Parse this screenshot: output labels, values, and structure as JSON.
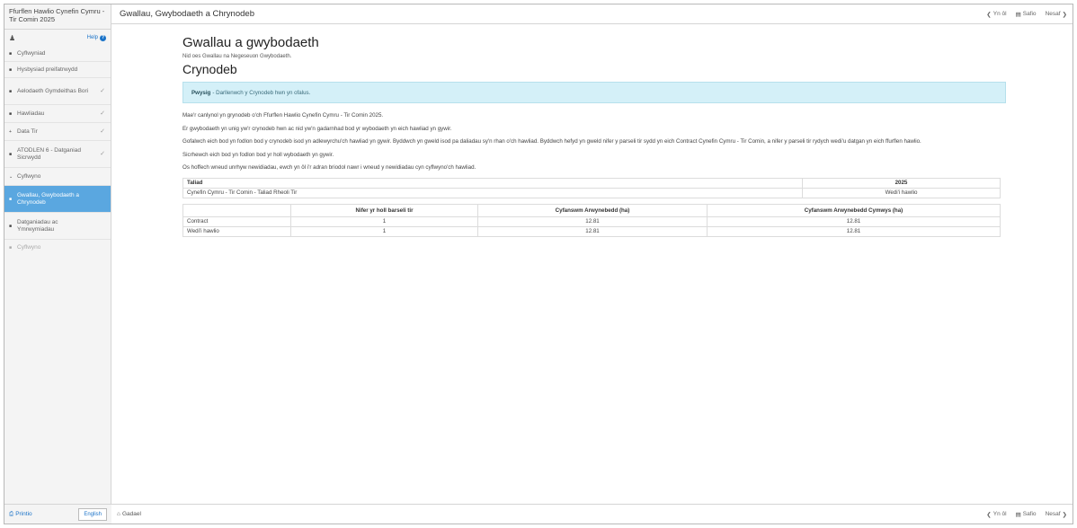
{
  "app": {
    "title": "Ffurflen Hawlio Cynefin Cymru - Tir Comin 2025"
  },
  "sidebar": {
    "help_label": "Help",
    "items": [
      {
        "label": "Cyflwyniad",
        "state": "normal",
        "check": false
      },
      {
        "label": "Hysbysiad preifatrwydd",
        "state": "normal",
        "check": false
      },
      {
        "label": "Aelodaeth Gymdeithas Bori",
        "state": "normal",
        "check": true
      },
      {
        "label": "Hawliadau",
        "state": "normal",
        "check": true
      },
      {
        "label": "Data Tir",
        "state": "normal",
        "check": true
      },
      {
        "label": "ATODLEN 6 - Datganiad Sicrwydd",
        "state": "normal",
        "check": true
      },
      {
        "label": "Cyflwyno",
        "state": "group",
        "check": false
      },
      {
        "label": "Gwallau, Gwybodaeth a Chrynodeb",
        "state": "active",
        "check": false
      },
      {
        "label": "Datganiadau ac Ymrwymiadau",
        "state": "normal",
        "check": false
      },
      {
        "label": "Cyflwyno",
        "state": "disabled",
        "check": false
      }
    ],
    "print_label": "Printio",
    "language_button": "English"
  },
  "topbar": {
    "page_title": "Gwallau, Gwybodaeth a Chrynodeb",
    "prev_label": "Yn ôl",
    "save_label": "Safio",
    "next_label": "Nesaf"
  },
  "bottombar": {
    "close_label": "Gadael",
    "prev_label": "Yn ôl",
    "save_label": "Safio",
    "next_label": "Nesaf"
  },
  "main": {
    "errors_heading": "Gwallau a gwybodaeth",
    "errors_text": "Nid oes Gwallau na Negeseuon Gwybodaeth.",
    "summary_heading": "Crynodeb",
    "alert_bold": "Pwysig",
    "alert_text": "- Darllenwch y Crynodeb hwn yn ofalus.",
    "paragraphs": [
      "Mae'r canlynol yn grynodeb o'ch Ffurflen Hawlio Cynefin Cymru - Tir Comin 2025.",
      "Er gwybodaeth yn unig yw'r crynodeb hwn ac nid yw'n gadarnhad bod yr wybodaeth yn eich hawliad yn gywir.",
      "Gofalwch eich bod yn fodlon bod y crynodeb isod yn adlewyrchu'ch hawliad yn gywir. Byddwch yn gweld isod pa daliadau sy'n rhan o'ch hawliad. Byddwch hefyd yn gweld nifer y parseli tir sydd yn eich Contract Cynefin Cymru - Tir Comin, a nifer y parseli tir rydych wedi'u datgan yn eich ffurflen hawlio.",
      "Sicrhewch eich bod yn fodlon bod yr holl wybodaeth yn gywir.",
      "Os hoffech wneud unrhyw newidiadau, ewch yn ôl i'r adran briodol nawr i wneud y newidiadau cyn cyflwyno'ch hawliad."
    ],
    "payment_table": {
      "headers": [
        "Taliad",
        "2025"
      ],
      "rows": [
        [
          "Cynefin Cymru - Tir Comin - Taliad Rheoli Tir",
          "Wedi'i hawlio"
        ]
      ]
    },
    "parcels_table": {
      "headers": [
        "",
        "Nifer yr holl barseli tir",
        "Cyfanswm Arwynebedd (ha)",
        "Cyfanswm Arwynebedd Cymwys (ha)"
      ],
      "rows": [
        [
          "Contract",
          "1",
          "12.81",
          "12.81"
        ],
        [
          "Wedi'i hawlio",
          "1",
          "12.81",
          "12.81"
        ]
      ]
    }
  },
  "colors": {
    "accent": "#1b73c8",
    "active_nav": "#5aa7e0",
    "alert_bg": "#d4f0f8"
  }
}
